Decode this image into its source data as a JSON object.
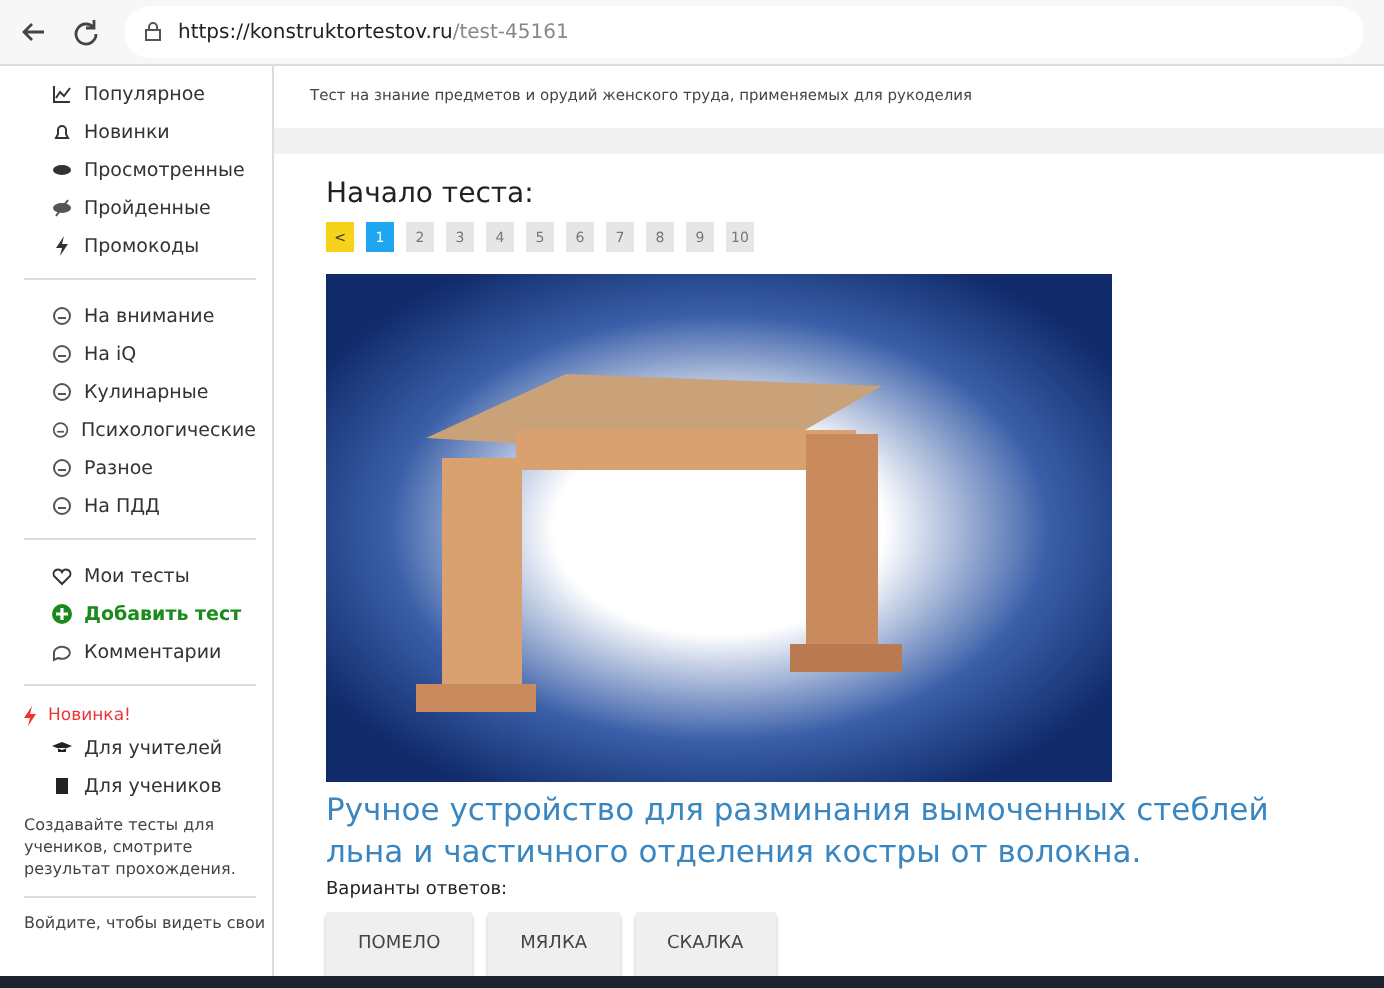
{
  "browser": {
    "url_host": "https://konstruktortestov.ru",
    "url_path": "/test-45161"
  },
  "sidebar": {
    "groups": [
      {
        "items": [
          {
            "label": "Популярное"
          },
          {
            "label": "Новинки"
          },
          {
            "label": "Просмотренные"
          },
          {
            "label": "Пройденные"
          },
          {
            "label": "Промокоды"
          }
        ]
      },
      {
        "items": [
          {
            "label": "На внимание"
          },
          {
            "label": "На iQ"
          },
          {
            "label": "Кулинарные"
          },
          {
            "label": "Психологические"
          },
          {
            "label": "Разное"
          },
          {
            "label": "На ПДД"
          }
        ]
      },
      {
        "items": [
          {
            "label": "Мои тесты",
            "highlight": false
          },
          {
            "label": "Добавить тест",
            "highlight": true
          },
          {
            "label": "Комментарии",
            "highlight": false
          }
        ]
      }
    ],
    "promo": {
      "badge": "Новинка!",
      "items": [
        {
          "label": "Для учителей"
        },
        {
          "label": "Для учеников"
        }
      ],
      "text": "Создавайте тесты для учеников, смотрите результат прохождения."
    },
    "login_note": "Войдите, чтобы видеть свои"
  },
  "description": "Тест на знание предметов и орудий женского труда, применяемых для рукоделия",
  "quiz": {
    "heading": "Начало теста:",
    "pages": [
      {
        "label": "<",
        "kind": "prev",
        "selected": false
      },
      {
        "label": "1",
        "kind": "page",
        "selected": true
      },
      {
        "label": "2",
        "kind": "page",
        "selected": false
      },
      {
        "label": "3",
        "kind": "page",
        "selected": false
      },
      {
        "label": "4",
        "kind": "page",
        "selected": false
      },
      {
        "label": "5",
        "kind": "page",
        "selected": false
      },
      {
        "label": "6",
        "kind": "page",
        "selected": false
      },
      {
        "label": "7",
        "kind": "page",
        "selected": false
      },
      {
        "label": "8",
        "kind": "page",
        "selected": false
      },
      {
        "label": "9",
        "kind": "page",
        "selected": false
      },
      {
        "label": "10",
        "kind": "page",
        "selected": false
      }
    ],
    "question": "Ручное устройство для разминания вымоченных стеблей льна и частичного отделения костры от волокна.",
    "answers_label": "Варианты ответов:",
    "answers": [
      "ПОМЕЛО",
      "МЯЛКА",
      "СКАЛКА"
    ]
  }
}
